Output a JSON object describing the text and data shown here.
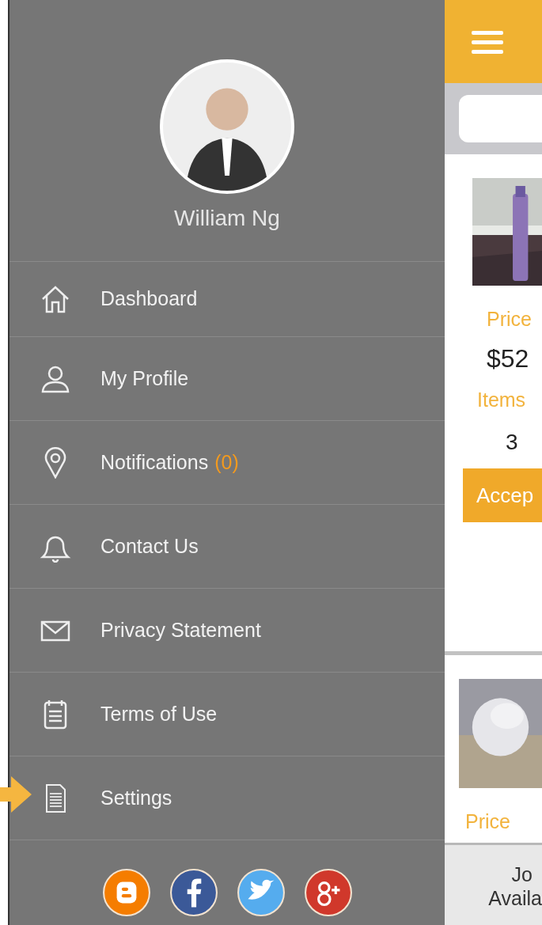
{
  "user": {
    "name": "William Ng"
  },
  "menu": [
    {
      "kind": "home",
      "label": "Dashboard",
      "marked": false
    },
    {
      "kind": "person",
      "label": "My Profile",
      "marked": false
    },
    {
      "kind": "pin",
      "label": "Notifications",
      "count": "(0)",
      "marked": false
    },
    {
      "kind": "bell",
      "label": "Contact Us",
      "marked": false
    },
    {
      "kind": "mail",
      "label": "Privacy Statement",
      "marked": false
    },
    {
      "kind": "calendar",
      "label": "Terms of Use",
      "marked": false
    },
    {
      "kind": "document",
      "label": "Settings",
      "marked": true
    }
  ],
  "social": [
    {
      "kind": "blogger",
      "color": "#f57d00"
    },
    {
      "kind": "facebook",
      "color": "#3b5998"
    },
    {
      "kind": "twitter",
      "color": "#55acee"
    },
    {
      "kind": "googleplus",
      "color": "#d0382b"
    }
  ],
  "listings": [
    {
      "price_label": "Price",
      "price": "$52",
      "items_label": "Items",
      "items": "3",
      "button": "Accep"
    },
    {
      "price_label": "Price"
    }
  ],
  "footer": {
    "line_1": "Jo",
    "line_2": "Availa"
  }
}
